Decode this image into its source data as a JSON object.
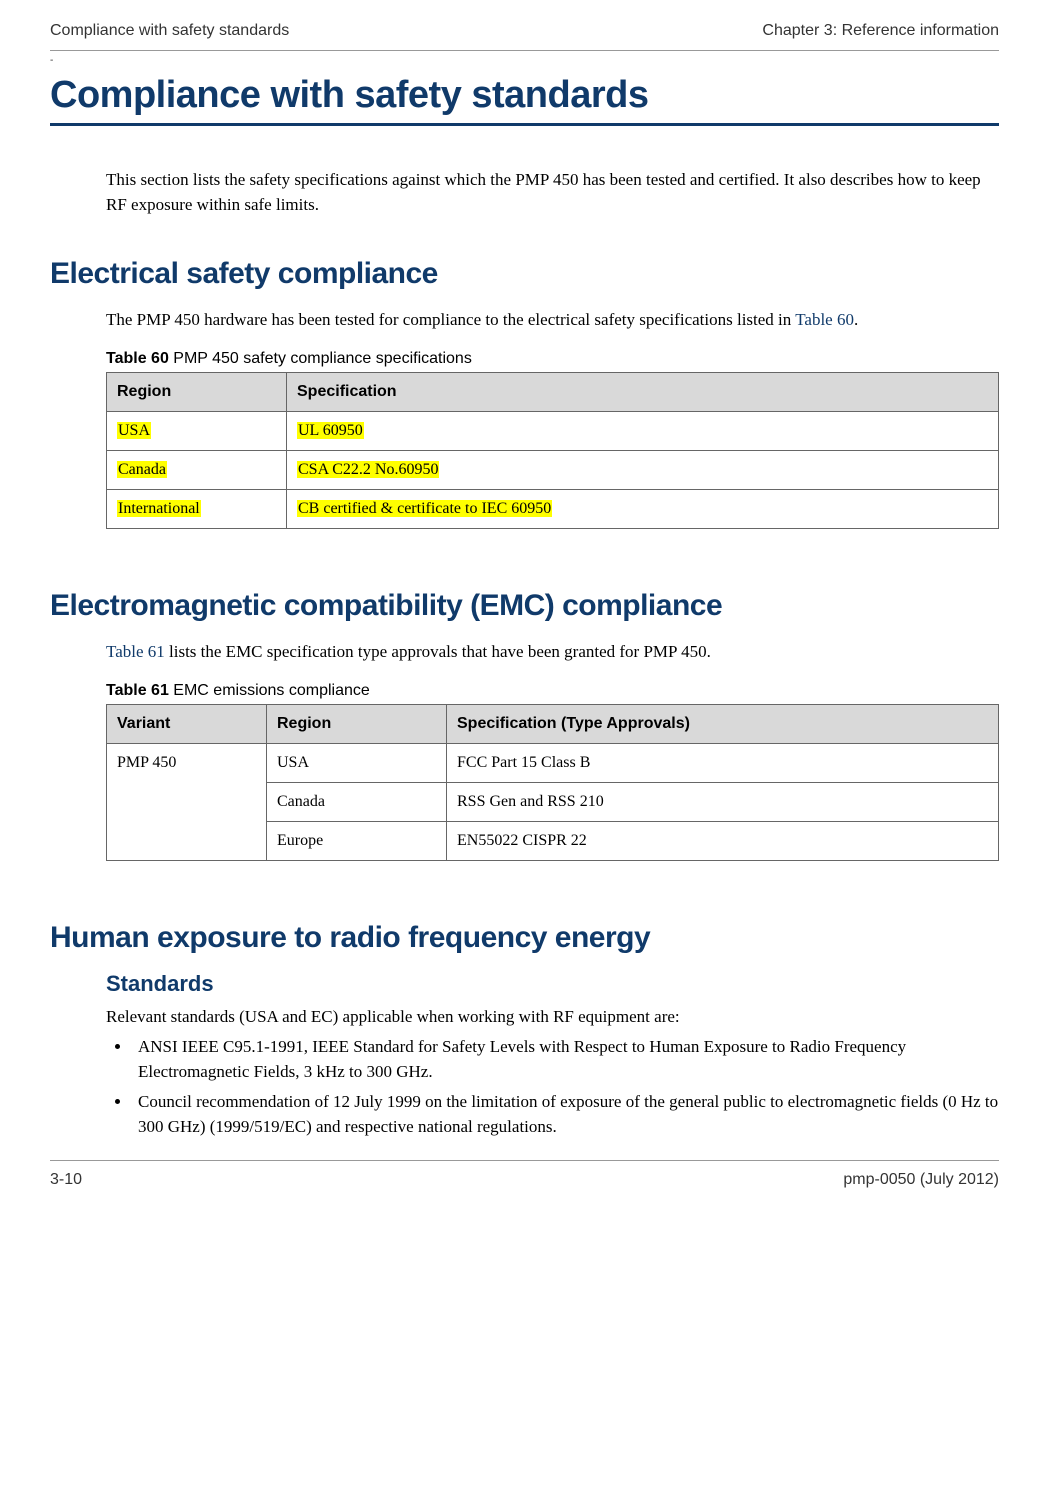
{
  "header": {
    "left": "Compliance with safety standards",
    "right": "Chapter 3:  Reference information"
  },
  "dash": "-",
  "title": "Compliance with safety standards",
  "intro": "This section lists the safety specifications against which the PMP 450 has been tested and certified. It also describes how to keep RF exposure within safe limits.",
  "s1": {
    "heading": "Electrical safety compliance",
    "para_a": "The PMP 450 hardware has been tested for compliance to the electrical safety specifications listed in ",
    "para_link": "Table 60",
    "para_b": ".",
    "caption_bold": "Table 60",
    "caption_rest": "  PMP 450 safety compliance specifications",
    "th1": "Region",
    "th2": "Specification",
    "rows": [
      {
        "r": "USA",
        "s": "UL 60950"
      },
      {
        "r": "Canada",
        "s": "CSA C22.2 No.60950"
      },
      {
        "r": "International",
        "s": "CB certified & certificate to IEC 60950"
      }
    ]
  },
  "s2": {
    "heading": "Electromagnetic compatibility (EMC) compliance",
    "para_link": "Table 61",
    "para_rest": " lists the EMC specification type approvals that have been granted for PMP 450.",
    "caption_bold": "Table 61",
    "caption_rest": "  EMC emissions compliance",
    "th1": "Variant",
    "th2": "Region",
    "th3": "Specification (Type Approvals)",
    "variant": "PMP 450",
    "rows": [
      {
        "r": "USA",
        "s": "FCC Part 15 Class B"
      },
      {
        "r": "Canada",
        "s": "RSS Gen and RSS 210"
      },
      {
        "r": "Europe",
        "s": "EN55022 CISPR 22"
      }
    ]
  },
  "s3": {
    "heading": "Human exposure to radio frequency energy",
    "sub": "Standards",
    "intro": "Relevant standards (USA and EC) applicable when working with RF equipment are:",
    "bullets": [
      "ANSI IEEE C95.1-1991, IEEE Standard for Safety Levels with Respect to Human Exposure to Radio Frequency Electromagnetic Fields, 3 kHz to 300 GHz.",
      "Council recommendation of 12 July 1999 on the limitation of exposure of the general public to electromagnetic fields (0 Hz to 300 GHz) (1999/519/EC) and respective national regulations."
    ]
  },
  "footer": {
    "left": "3-10",
    "right": "pmp-0050 (July 2012)"
  }
}
